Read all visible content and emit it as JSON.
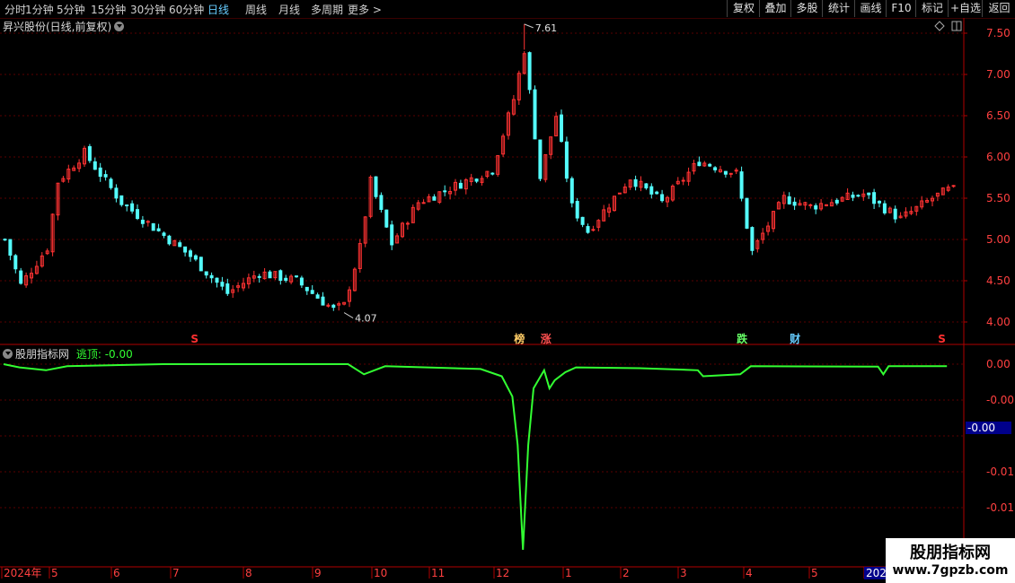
{
  "toolbar": {
    "left_tabs": [
      "分时",
      "1分钟",
      "5分钟",
      "15分钟",
      "30分钟",
      "60分钟",
      "日线",
      "周线",
      "月线",
      "多周期",
      "更多"
    ],
    "right_buttons": [
      "复权",
      "叠加",
      "多股",
      "统计",
      "画线",
      "F10",
      "标记",
      "+自选",
      "返回"
    ]
  },
  "main_chart": {
    "title": "昇兴股份(日线,前复权)",
    "colors": {
      "up": "#ff3232",
      "down": "#54fcfc",
      "grid": "#5a0000",
      "axis": "#b00000"
    }
  },
  "indicator": {
    "name": "股朋指标网",
    "series_label": "逃顶: -0.00",
    "current_value": "-0.00",
    "line_color": "#32ff32"
  },
  "markers": [
    {
      "label": "S",
      "color": "#ff3030",
      "bar": 36
    },
    {
      "label": "榜",
      "color": "#ffcc66",
      "bar": 97
    },
    {
      "label": "涨",
      "color": "#ff5050",
      "bar": 102
    },
    {
      "label": "跌",
      "color": "#66ff66",
      "bar": 139
    },
    {
      "label": "财",
      "color": "#66ccff",
      "bar": 149
    },
    {
      "label": "S",
      "color": "#ff3030",
      "bar": 177
    }
  ],
  "watermark": {
    "line1": "股朋指标网",
    "line2": "www.7gpzb.com"
  },
  "chart_data": [
    {
      "type": "candlestick",
      "title": "昇兴股份(日线,前复权)",
      "ylim": [
        3.9,
        7.75
      ],
      "y_ticks": [
        "7.50",
        "7.00",
        "6.50",
        "6.00",
        "5.50",
        "5.00",
        "4.50",
        "4.00"
      ],
      "x_ticks": [
        "2024年",
        "5",
        "6",
        "7",
        "8",
        "9",
        "10",
        "11",
        "12",
        "1",
        "2",
        "3",
        "4",
        "5",
        "202"
      ],
      "annotations": {
        "high": "7.61",
        "low": "4.07"
      },
      "key_points": [
        {
          "bar": 0,
          "close": 5.0
        },
        {
          "bar": 3,
          "close": 4.45
        },
        {
          "bar": 8,
          "close": 4.9
        },
        {
          "bar": 10,
          "close": 5.7
        },
        {
          "bar": 15,
          "close": 6.05
        },
        {
          "bar": 22,
          "close": 5.45
        },
        {
          "bar": 35,
          "close": 4.8
        },
        {
          "bar": 42,
          "close": 4.35
        },
        {
          "bar": 48,
          "close": 4.6
        },
        {
          "bar": 55,
          "close": 4.5
        },
        {
          "bar": 58,
          "close": 4.35
        },
        {
          "bar": 62,
          "close": 4.15
        },
        {
          "bar": 64,
          "close": 4.2
        },
        {
          "bar": 67,
          "close": 4.9
        },
        {
          "bar": 69,
          "close": 5.7
        },
        {
          "bar": 73,
          "close": 4.95
        },
        {
          "bar": 78,
          "close": 5.45
        },
        {
          "bar": 85,
          "close": 5.65
        },
        {
          "bar": 92,
          "close": 5.85
        },
        {
          "bar": 96,
          "close": 6.7
        },
        {
          "bar": 98,
          "close": 7.3
        },
        {
          "bar": 101,
          "close": 5.75
        },
        {
          "bar": 104,
          "close": 6.5
        },
        {
          "bar": 107,
          "close": 5.4
        },
        {
          "bar": 110,
          "close": 5.1
        },
        {
          "bar": 118,
          "close": 5.75
        },
        {
          "bar": 124,
          "close": 5.45
        },
        {
          "bar": 131,
          "close": 5.95
        },
        {
          "bar": 138,
          "close": 5.8
        },
        {
          "bar": 141,
          "close": 4.85
        },
        {
          "bar": 147,
          "close": 5.5
        },
        {
          "bar": 152,
          "close": 5.4
        },
        {
          "bar": 162,
          "close": 5.55
        },
        {
          "bar": 169,
          "close": 5.25
        },
        {
          "bar": 175,
          "close": 5.5
        },
        {
          "bar": 178,
          "close": 5.6
        }
      ]
    },
    {
      "type": "line",
      "title": "逃顶",
      "y_ticks": [
        "0.00",
        "-0.00",
        "-0.01",
        "-0.01"
      ],
      "series": [
        {
          "values_by_bar": [
            [
              0,
              0.0
            ],
            [
              3,
              -0.0008
            ],
            [
              8,
              -0.0015
            ],
            [
              12,
              -0.0005
            ],
            [
              30,
              0.0
            ],
            [
              65,
              0.0
            ],
            [
              68,
              -0.0025
            ],
            [
              72,
              -0.0005
            ],
            [
              90,
              -0.0012
            ],
            [
              94,
              -0.003
            ],
            [
              96,
              -0.008
            ],
            [
              97,
              -0.02
            ],
            [
              98,
              -0.046
            ],
            [
              99,
              -0.02
            ],
            [
              100,
              -0.006
            ],
            [
              102,
              -0.0015
            ],
            [
              103,
              -0.006
            ],
            [
              104,
              -0.004
            ],
            [
              106,
              -0.002
            ],
            [
              108,
              -0.0008
            ],
            [
              120,
              -0.001
            ],
            [
              131,
              -0.0015
            ],
            [
              132,
              -0.003
            ],
            [
              139,
              -0.0025
            ],
            [
              141,
              -0.0005
            ],
            [
              165,
              -0.0006
            ],
            [
              166,
              -0.0025
            ],
            [
              167,
              -0.0005
            ],
            [
              178,
              -0.0005
            ]
          ]
        }
      ]
    }
  ]
}
